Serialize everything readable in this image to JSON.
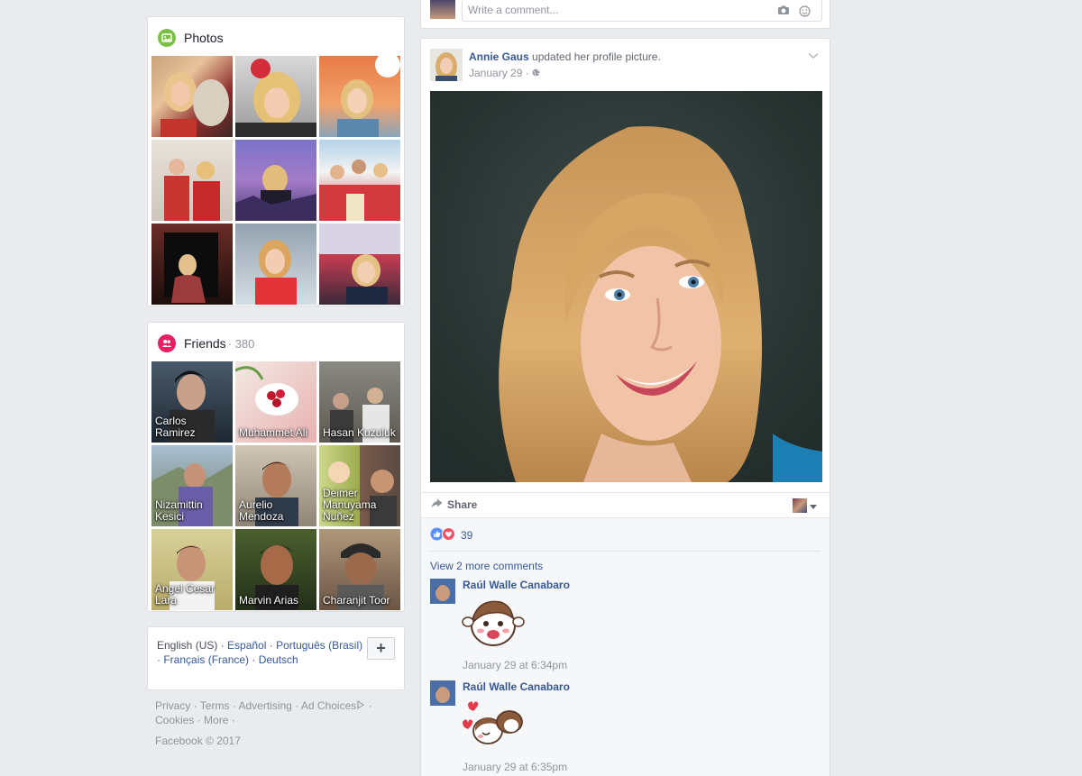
{
  "photos": {
    "title": "Photos",
    "icon": "photo-icon",
    "accent": "#7ac143"
  },
  "friends": {
    "title": "Friends",
    "count": "· 380",
    "icon": "friends-icon",
    "accent": "#e91e63",
    "items": [
      {
        "name": "Carlos Ramirez"
      },
      {
        "name": "Muhammet Ali"
      },
      {
        "name": "Hasan Kuzuluk"
      },
      {
        "name": "Nizamittin Kesici"
      },
      {
        "name": "Aurelio Mendoza"
      },
      {
        "name": "Deimer Manuyama Nuñez"
      },
      {
        "name": "Angel Cesar Lara"
      },
      {
        "name": "Marvin Arias"
      },
      {
        "name": "Charanjit Toor"
      }
    ]
  },
  "languages": {
    "current": "English (US)",
    "links": [
      "Español",
      "Português (Brasil)",
      "Français (France)",
      "Deutsch"
    ],
    "add_label": "+"
  },
  "footer": {
    "privacy": "Privacy",
    "terms": "Terms",
    "advertising": "Advertising",
    "ad_choices": "Ad Choices",
    "cookies": "Cookies",
    "more": "More",
    "copyright": "Facebook © 2017"
  },
  "prev_comment": {
    "placeholder": "Write a comment..."
  },
  "post": {
    "author": "Annie Gaus",
    "action": "updated her profile picture.",
    "date": "January 29 ·",
    "share_label": "Share",
    "reaction_count": "39",
    "view_more": "View 2 more comments",
    "comments": [
      {
        "author": "Raúl Walle Canabaro",
        "time": "January 29 at 6:34pm"
      },
      {
        "author": "Raúl Walle Canabaro",
        "time": "January 29 at 6:35pm"
      }
    ]
  },
  "colors": {
    "link": "#365899",
    "background": "#e9ebee",
    "like_blue": "#5890ff",
    "love_red": "#f25268"
  }
}
